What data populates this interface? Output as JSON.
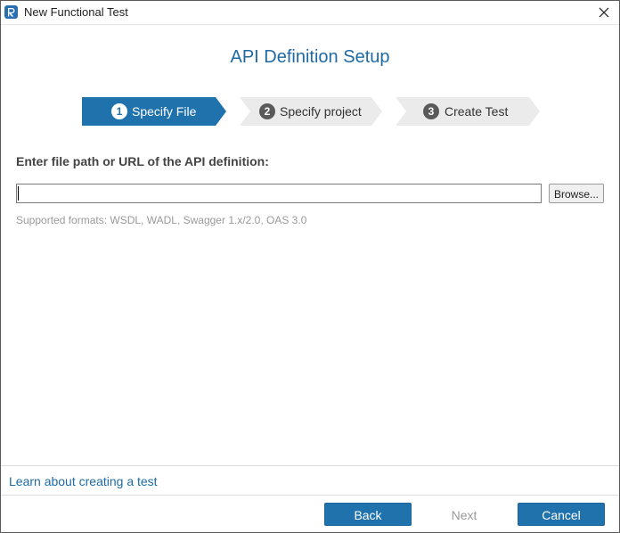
{
  "window": {
    "title": "New Functional Test"
  },
  "heading": "API Definition Setup",
  "steps": [
    {
      "number": "1",
      "label": "Specify File",
      "active": true
    },
    {
      "number": "2",
      "label": "Specify project",
      "active": false
    },
    {
      "number": "3",
      "label": "Create Test",
      "active": false
    }
  ],
  "form": {
    "prompt": "Enter file path or URL of the API definition:",
    "path_value": "",
    "browse_label": "Browse...",
    "formats_note": "Supported formats: WSDL, WADL, Swagger 1.x/2.0, OAS 3.0"
  },
  "footer": {
    "learn_link": "Learn about creating a test",
    "back_label": "Back",
    "next_label": "Next",
    "cancel_label": "Cancel"
  },
  "colors": {
    "accent": "#2072ad",
    "heading": "#1f6aa4",
    "step_inactive_bg": "#ebebeb",
    "step_inactive_num": "#5a5a5a"
  },
  "icons": {
    "app": "readyapi-logo-icon",
    "close": "close-icon"
  }
}
